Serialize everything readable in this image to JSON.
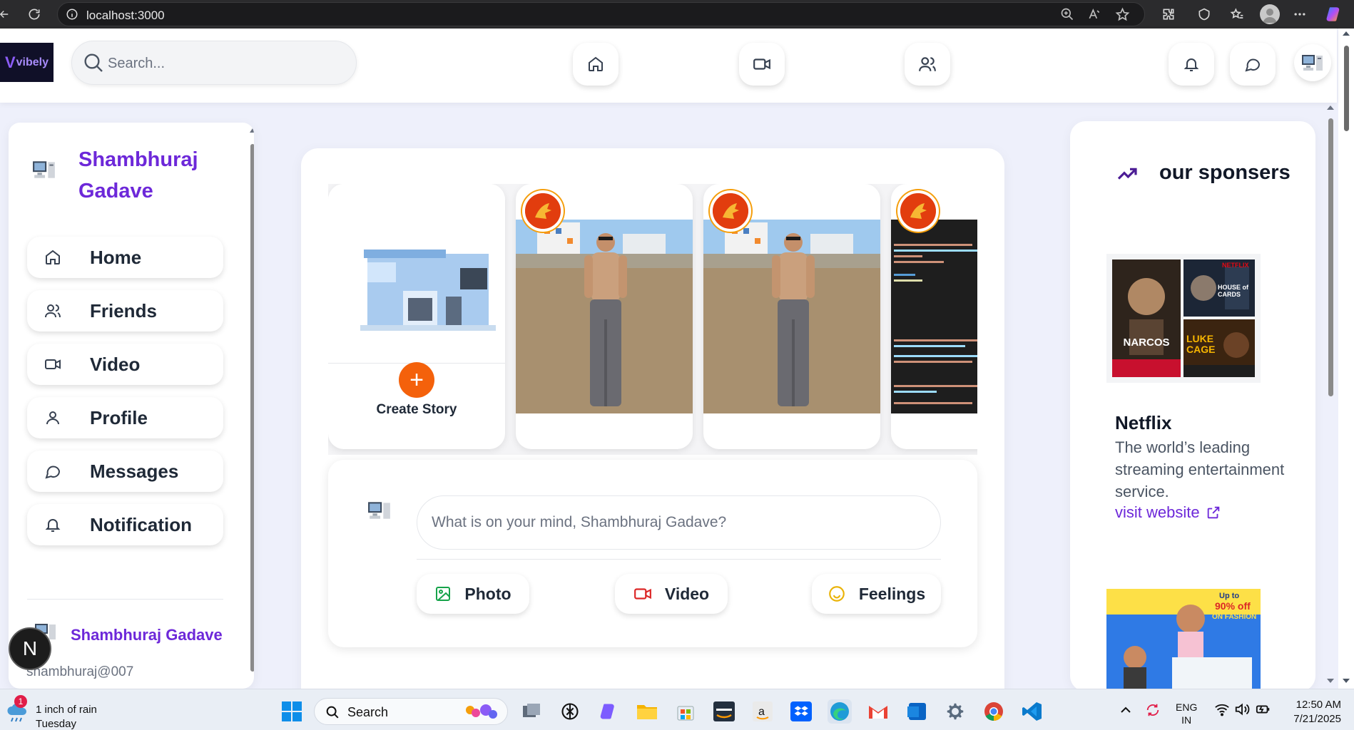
{
  "browser": {
    "url": "localhost:3000"
  },
  "header": {
    "logo_text": "vibely",
    "logo_mark": "V",
    "search_placeholder": "Search...",
    "nav": [
      {
        "name": "home",
        "icon": "home-icon"
      },
      {
        "name": "video",
        "icon": "video-icon"
      },
      {
        "name": "friends",
        "icon": "users-icon"
      }
    ],
    "actions": [
      {
        "name": "notifications",
        "icon": "bell-icon"
      },
      {
        "name": "messages",
        "icon": "message-circle-icon"
      }
    ]
  },
  "sidebar": {
    "profile_name": "Shambhuraj Gadave",
    "items": [
      {
        "label": "Home",
        "icon": "home-icon"
      },
      {
        "label": "Friends",
        "icon": "users-icon"
      },
      {
        "label": "Video",
        "icon": "video-icon"
      },
      {
        "label": "Profile",
        "icon": "user-icon"
      },
      {
        "label": "Messages",
        "icon": "message-circle-icon"
      },
      {
        "label": "Notification",
        "icon": "bell-icon"
      }
    ],
    "footer_name": "Shambhuraj Gadave",
    "footer_handle": "shambhuraj@007",
    "floating_badge": "N"
  },
  "feed": {
    "create_story_label": "Create Story",
    "create_story_plus": "+",
    "composer_placeholder": "What is on your mind, Shambhuraj Gadave?",
    "composer_actions": [
      {
        "label": "Photo",
        "icon": "image-icon",
        "color": "#16a34a"
      },
      {
        "label": "Video",
        "icon": "video-icon",
        "color": "#dc2626"
      },
      {
        "label": "Feelings",
        "icon": "smile-icon",
        "color": "#eab308"
      }
    ]
  },
  "sponsors": {
    "heading": "our sponsers",
    "ads": [
      {
        "title": "Netflix",
        "description": "The world’s leading streaming entertainment service.",
        "link_text": "visit website",
        "poster_texts": [
          "NETFLIX",
          "NARCOS",
          "HOUSE of CARDS",
          "LUKE CAGE"
        ]
      },
      {
        "poster_texts": [
          "Up to",
          "90% off",
          "ON FASHION"
        ]
      }
    ]
  },
  "taskbar": {
    "weather_badge": "1",
    "weather_line1": "1 inch of rain",
    "weather_line2": "Tuesday",
    "search_label": "Search",
    "lang_line1": "ENG",
    "lang_line2": "IN",
    "time": "12:50 AM",
    "date": "7/21/2025"
  },
  "colors": {
    "brand": "#6d28d9",
    "accent_orange": "#f4610b",
    "page_bg": "#eef0fb"
  }
}
